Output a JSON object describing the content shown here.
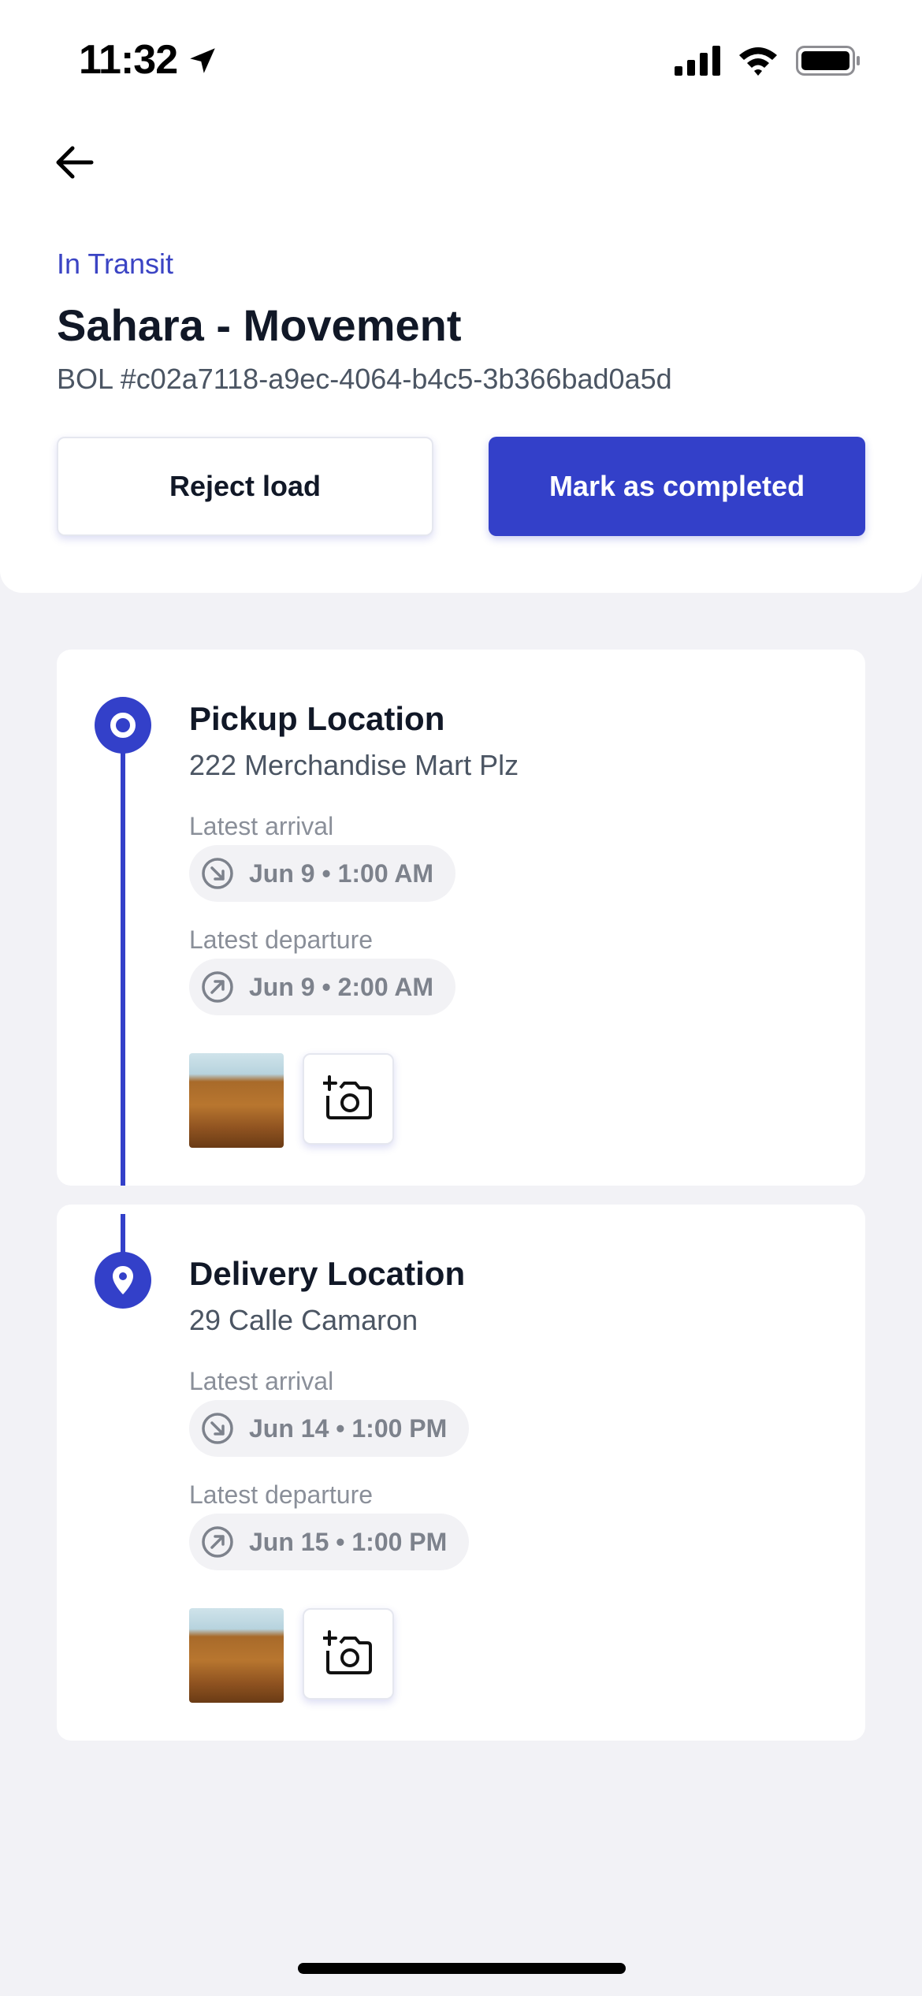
{
  "status_bar": {
    "time": "11:32",
    "icons": [
      "location-arrow-icon",
      "cellular-signal-icon",
      "wifi-icon",
      "battery-icon"
    ]
  },
  "header": {
    "back_icon": "arrow-left-icon",
    "status": "In Transit",
    "title": "Sahara - Movement",
    "bol": "BOL #c02a7118-a9ec-4064-b4c5-3b366bad0a5d"
  },
  "actions": {
    "reject_label": "Reject load",
    "complete_label": "Mark as completed"
  },
  "stops": [
    {
      "title": "Pickup Location",
      "address": "222 Merchandise Mart Plz",
      "arrival_label": "Latest arrival",
      "arrival_value": "Jun 9 • 1:00 AM",
      "departure_label": "Latest departure",
      "departure_value": "Jun 9 • 2:00 AM",
      "marker_icon": "ring-marker-icon"
    },
    {
      "title": "Delivery Location",
      "address": "29 Calle Camaron",
      "arrival_label": "Latest arrival",
      "arrival_value": "Jun 14 • 1:00 PM",
      "departure_label": "Latest departure",
      "departure_value": "Jun 15 • 1:00 PM",
      "marker_icon": "map-pin-icon"
    }
  ],
  "colors": {
    "accent": "#3340c9",
    "background": "#f2f2f6",
    "chip_background": "#f2f2f5",
    "status_text": "#3b44c4"
  }
}
